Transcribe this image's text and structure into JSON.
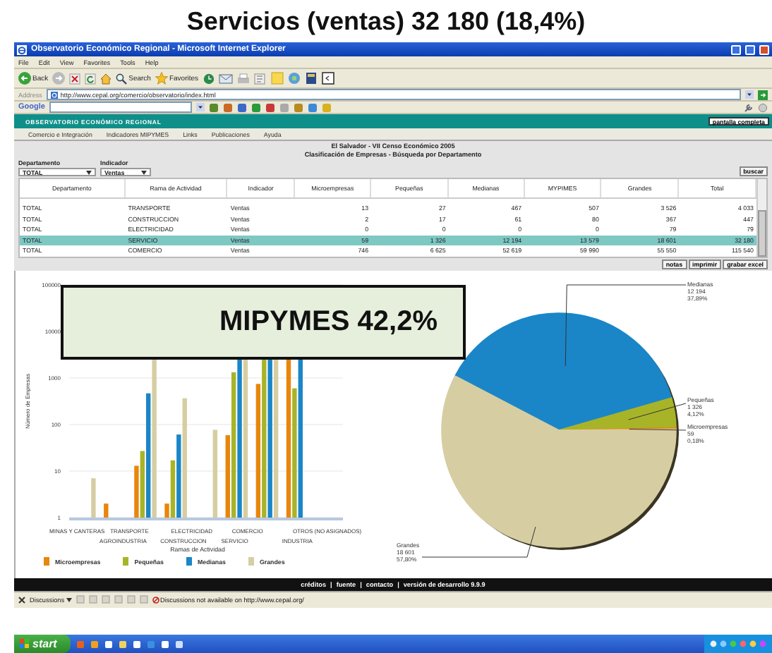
{
  "slide_title": "Servicios (ventas) 32 180 (18,4%)",
  "window": {
    "title": "Observatorio Económico Regional - Microsoft Internet Explorer"
  },
  "menu": [
    "File",
    "Edit",
    "View",
    "Favorites",
    "Tools",
    "Help"
  ],
  "toolbar": {
    "back": "Back",
    "search": "Search",
    "favorites": "Favorites"
  },
  "address": {
    "label": "Address",
    "url": "http://www.cepal.org/comercio/observatorio/index.html"
  },
  "google_bar": {
    "logo": "Google"
  },
  "site": {
    "title": "OBSERVATORIO ECONÓMICO REGIONAL",
    "fullscreen_button": "pantalla completa",
    "nav": [
      "Comercio e Integración",
      "Indicadores MIPYMES",
      "Links",
      "Publicaciones",
      "Ayuda"
    ]
  },
  "report": {
    "title": "El Salvador - VII Censo Económico 2005",
    "subtitle": "Clasificación de Empresas - Búsqueda por Departamento",
    "filters": [
      {
        "label": "Departamento",
        "value": "TOTAL"
      },
      {
        "label": "Indicador",
        "value": "Ventas"
      }
    ],
    "search_button": "buscar",
    "table": {
      "columns": [
        "Departamento",
        "Rama de Actividad",
        "Indicador",
        "Microempresas",
        "Pequeñas",
        "Medianas",
        "MYPIMES",
        "Grandes",
        "Total"
      ],
      "rows": [
        {
          "cells": [
            "TOTAL",
            "TRANSPORTE",
            "Ventas",
            "13",
            "27",
            "467",
            "507",
            "3 526",
            "4 033"
          ],
          "selected": false
        },
        {
          "cells": [
            "TOTAL",
            "CONSTRUCCION",
            "Ventas",
            "2",
            "17",
            "61",
            "80",
            "367",
            "447"
          ],
          "selected": false
        },
        {
          "cells": [
            "TOTAL",
            "ELECTRICIDAD",
            "Ventas",
            "0",
            "0",
            "0",
            "0",
            "79",
            "79"
          ],
          "selected": false
        },
        {
          "cells": [
            "TOTAL",
            "SERVICIO",
            "Ventas",
            "59",
            "1 326",
            "12 194",
            "13 579",
            "18 601",
            "32 180"
          ],
          "selected": true
        },
        {
          "cells": [
            "TOTAL",
            "COMERCIO",
            "Ventas",
            "746",
            "6 625",
            "52 619",
            "59 990",
            "55 550",
            "115 540"
          ],
          "selected": false
        }
      ]
    },
    "actions": [
      "notas",
      "imprimir",
      "grabar excel"
    ]
  },
  "bar_chart": {
    "ylabel": "Número de Empresas",
    "y_axis_labels": [
      "100000",
      "10000",
      "1000",
      "100",
      "10",
      "1"
    ],
    "x_axis_label_rows": [
      [
        "MINAS Y CANTERAS",
        "TRANSPORTE",
        "ELECTRICIDAD",
        "COMERCIO",
        "OTROS (NO ASIGNADOS)"
      ],
      [
        "AGROINDUSTRIA",
        "CONSTRUCCION",
        "SERVICIO",
        "INDUSTRIA"
      ]
    ],
    "xlabel": "Ramas de Actividad",
    "legend": [
      {
        "name": "Microempresas",
        "color": "#e8860c"
      },
      {
        "name": "Pequeñas",
        "color": "#a8b428"
      },
      {
        "name": "Medianas",
        "color": "#1a86c8"
      },
      {
        "name": "Grandes",
        "color": "#d6cea2"
      }
    ]
  },
  "pie_chart": {
    "chart_data": {
      "type": "pie",
      "categories": [
        "Medianas",
        "Pequeñas",
        "Microempresas",
        "Grandes"
      ],
      "values": [
        12194,
        1326,
        59,
        18601
      ],
      "data_labels": true
    },
    "slices": [
      {
        "value_label": "12 194",
        "percent": "37,89%",
        "color": "#1a86c8"
      },
      {
        "value_label": "1 326",
        "percent": "4,12%",
        "color": "#a8b428"
      },
      {
        "value_label": "59",
        "percent": "0,18%",
        "color": "#e8860c"
      },
      {
        "value_label": "18 601",
        "percent": "57,80%",
        "color": "#d6cea2"
      }
    ]
  },
  "overlay": {
    "text": "MIPYMES 42,2%"
  },
  "footer": {
    "links": [
      "créditos",
      "fuente",
      "contacto",
      "versión de desarrollo 9.9.9"
    ],
    "separators": [
      "|",
      "|",
      "|"
    ]
  },
  "discussions": {
    "button": "Discussions",
    "message": "Discussions not available on http://www.cepal.org/"
  },
  "taskbar": {
    "start": "start"
  }
}
